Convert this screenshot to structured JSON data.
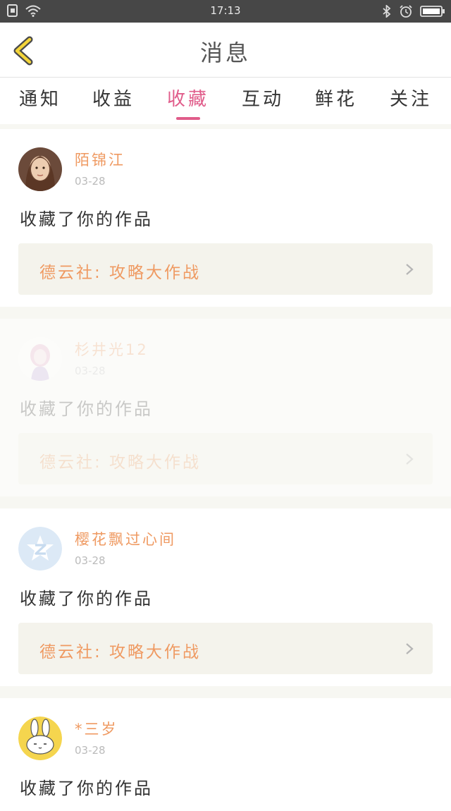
{
  "status_bar": {
    "time": "17:13"
  },
  "nav": {
    "title": "消息"
  },
  "tabs": [
    {
      "label": "通知",
      "active": false
    },
    {
      "label": "收益",
      "active": false
    },
    {
      "label": "收藏",
      "active": true
    },
    {
      "label": "互动",
      "active": false
    },
    {
      "label": "鲜花",
      "active": false
    },
    {
      "label": "关注",
      "active": false
    }
  ],
  "accent_color": "#e05c8a",
  "name_color": "#ef9a62",
  "feed": [
    {
      "user": "陌锦江",
      "date": "03-28",
      "action": "收藏了你的作品",
      "work": "德云社: 攻略大作战"
    },
    {
      "user": "杉井光12",
      "date": "03-28",
      "action": "收藏了你的作品",
      "work": "德云社: 攻略大作战"
    },
    {
      "user": "樱花飘过心间",
      "date": "03-28",
      "action": "收藏了你的作品",
      "work": "德云社: 攻略大作战"
    },
    {
      "user": "*三岁",
      "date": "03-28",
      "action": "收藏了你的作品"
    }
  ]
}
